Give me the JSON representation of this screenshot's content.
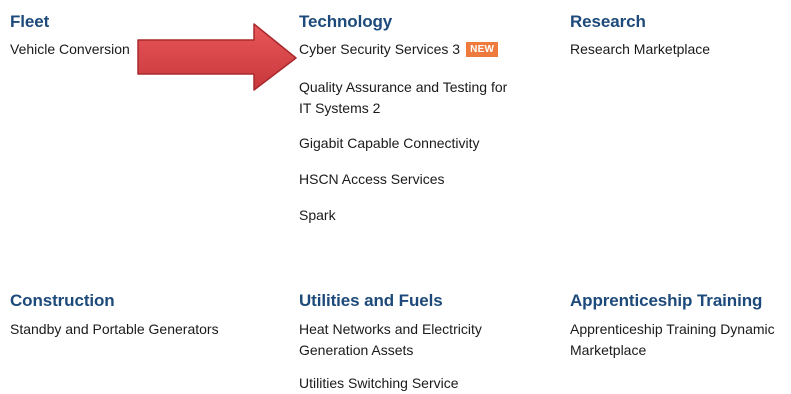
{
  "sections": {
    "fleet": {
      "title": "Fleet",
      "items": [
        "Vehicle Conversion"
      ]
    },
    "technology": {
      "title": "Technology",
      "items": [
        "Cyber Security Services 3",
        "Quality Assurance and Testing for",
        "IT Systems 2",
        "Gigabit Capable Connectivity",
        "HSCN Access Services",
        "Spark"
      ],
      "badge": "NEW"
    },
    "research": {
      "title": "Research",
      "items": [
        "Research Marketplace"
      ]
    },
    "construction": {
      "title": "Construction",
      "items": [
        "Standby and Portable Generators"
      ]
    },
    "utilities": {
      "title": "Utilities and Fuels",
      "items": [
        "Heat Networks and Electricity",
        "Generation Assets",
        "Utilities Switching Service"
      ]
    },
    "apprenticeship": {
      "title": "Apprenticeship Training",
      "items": [
        "Apprenticeship Training Dynamic",
        "Marketplace"
      ]
    }
  },
  "colors": {
    "heading": "#1d4a7a",
    "badge": "#ef7a3d",
    "arrow": "#e0484c"
  },
  "annotation": {
    "icon": "arrow-right-icon"
  }
}
